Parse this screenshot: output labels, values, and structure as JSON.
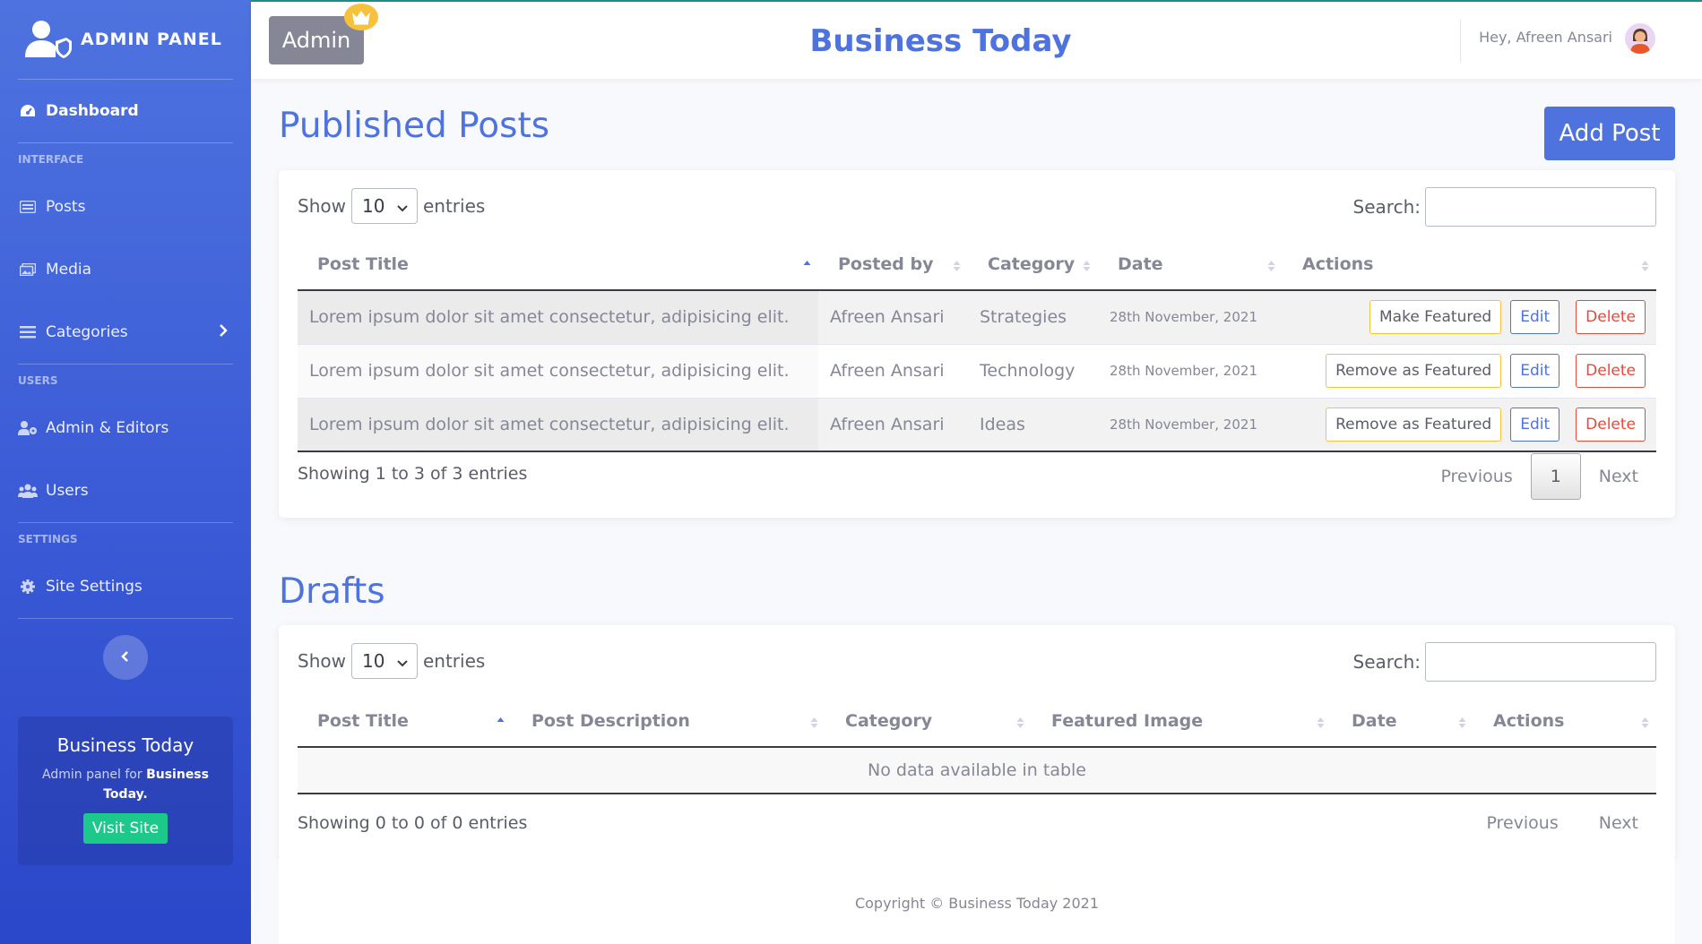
{
  "sidebar": {
    "brand": "ADMIN PANEL",
    "items": {
      "dashboard": "Dashboard",
      "posts": "Posts",
      "media": "Media",
      "categories": "Categories",
      "admin_editors": "Admin & Editors",
      "users": "Users",
      "site_settings": "Site Settings"
    },
    "headings": {
      "interface": "INTERFACE",
      "users": "USERS",
      "settings": "SETTINGS"
    },
    "card": {
      "title": "Business Today",
      "desc_prefix": "Admin panel for",
      "desc_bold": "Business Today.",
      "button": "Visit Site"
    }
  },
  "topbar": {
    "badge": "Admin",
    "title": "Business Today",
    "greeting": "Hey, Afreen Ansari"
  },
  "published": {
    "title": "Published Posts",
    "add_button": "Add Post",
    "show_label": "Show",
    "entries_label": "entries",
    "page_size": "10",
    "search_label": "Search:",
    "columns": [
      "Post Title",
      "Posted by",
      "Category",
      "Date",
      "Actions"
    ],
    "rows": [
      {
        "title": "Lorem ipsum dolor sit amet consectetur, adipisicing elit.",
        "posted_by": "Afreen Ansari",
        "category": "Strategies",
        "date": "28th November, 2021",
        "feature_action": "Make Featured"
      },
      {
        "title": "Lorem ipsum dolor sit amet consectetur, adipisicing elit.",
        "posted_by": "Afreen Ansari",
        "category": "Technology",
        "date": "28th November, 2021",
        "feature_action": "Remove as Featured"
      },
      {
        "title": "Lorem ipsum dolor sit amet consectetur, adipisicing elit.",
        "posted_by": "Afreen Ansari",
        "category": "Ideas",
        "date": "28th November, 2021",
        "feature_action": "Remove as Featured"
      }
    ],
    "edit_label": "Edit",
    "delete_label": "Delete",
    "info": "Showing 1 to 3 of 3 entries",
    "prev": "Previous",
    "page": "1",
    "next": "Next"
  },
  "drafts": {
    "title": "Drafts",
    "show_label": "Show",
    "entries_label": "entries",
    "page_size": "10",
    "search_label": "Search:",
    "columns": [
      "Post Title",
      "Post Description",
      "Category",
      "Featured Image",
      "Date",
      "Actions"
    ],
    "empty": "No data available in table",
    "info": "Showing 0 to 0 of 0 entries",
    "prev": "Previous",
    "next": "Next"
  },
  "footer": "Copyright © Business Today 2021",
  "colors": {
    "primary": "#4e73df",
    "success": "#1cc88a",
    "warning": "#f6c23e",
    "danger": "#e74a3b",
    "secondary": "#858796"
  }
}
